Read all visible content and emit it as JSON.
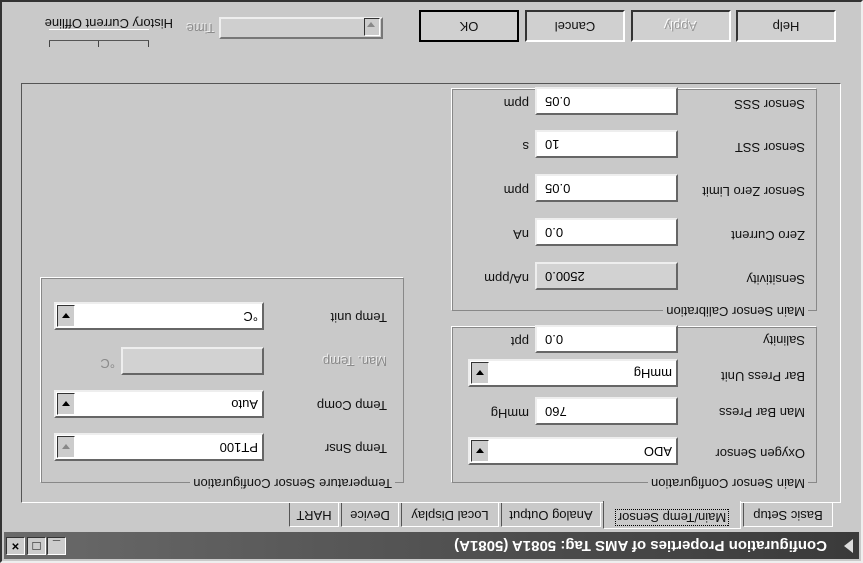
{
  "window": {
    "title": "Configuration Properties of AMS Tag: 5081A (5081A)",
    "controls": [
      "_",
      "□",
      "×"
    ]
  },
  "tabs": [
    {
      "label": "Basic Setup"
    },
    {
      "label": "Main/Temp Sensor"
    },
    {
      "label": "Analog Output"
    },
    {
      "label": "Local Display"
    },
    {
      "label": "Device"
    },
    {
      "label": "HART"
    }
  ],
  "main_config": {
    "title": "Main Sensor Configuration",
    "oxygen_sensor": {
      "label": "Oxygen Sensor",
      "value": "ADO"
    },
    "man_bar_press": {
      "label": "Man Bar Press",
      "value": "760",
      "unit": "mmHg"
    },
    "bar_press_unit": {
      "label": "Bar Press Unit",
      "value": "mmHg"
    },
    "salinity": {
      "label": "Salinity",
      "value": "0.0",
      "unit": "ppt"
    }
  },
  "main_calibration": {
    "title": "Main Sensor Calibration",
    "sensitivity": {
      "label": "Sensitivity",
      "value": "2500.0",
      "unit": "nA/ppm"
    },
    "zero_current": {
      "label": "Zero Current",
      "value": "0.0",
      "unit": "nA"
    },
    "sensor_zero_limit": {
      "label": "Sensor Zero Limit",
      "value": "0.05",
      "unit": "ppm"
    },
    "sensor_sst": {
      "label": "Sensor SST",
      "value": "10",
      "unit": "s"
    },
    "sensor_sss": {
      "label": "Sensor SSS",
      "value": "0.05",
      "unit": "ppm"
    }
  },
  "temp_config": {
    "title": "Temperature Sensor Configuration",
    "temp_snsr": {
      "label": "Temp Snsr",
      "value": "PT100"
    },
    "temp_comp": {
      "label": "Temp Comp",
      "value": "Auto"
    },
    "man_temp": {
      "label": "Man. Temp",
      "value": "",
      "unit": "°C"
    },
    "temp_unit": {
      "label": "Temp unit",
      "value": "°C"
    }
  },
  "buttons": {
    "ok": "OK",
    "cancel": "Cancel",
    "apply": "Apply",
    "help": "Help"
  },
  "time": {
    "label": "Time"
  },
  "mode_labels": "History  Current  Offline"
}
